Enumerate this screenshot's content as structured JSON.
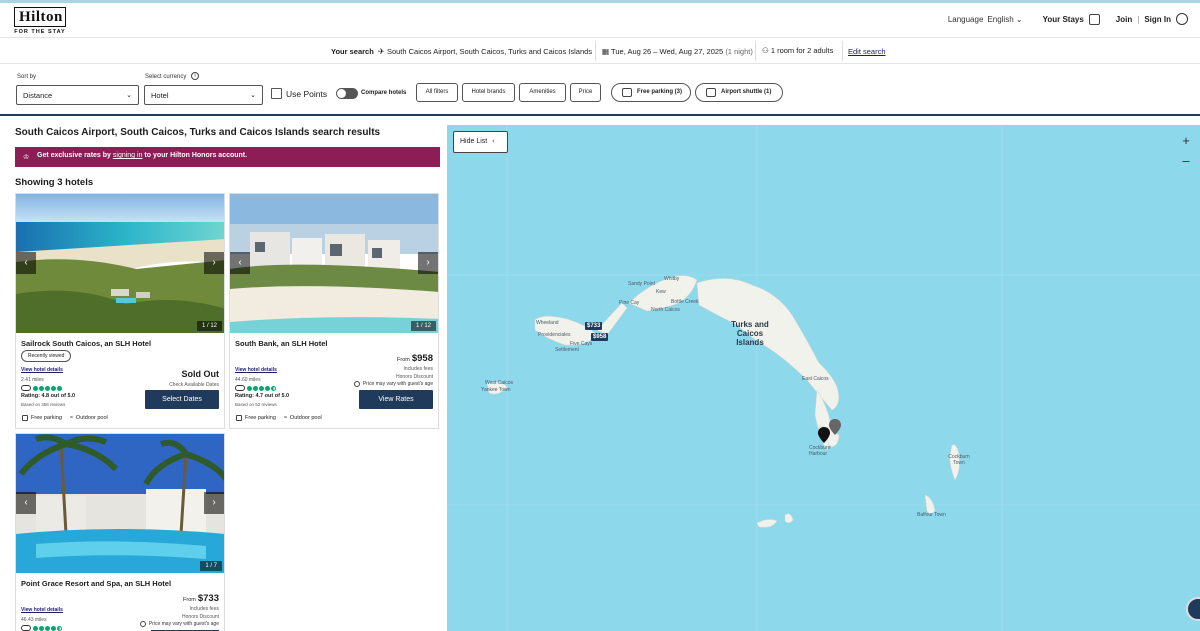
{
  "header": {
    "logo_main": "Hilton",
    "logo_tag": "FOR THE STAY",
    "language_label": "Language",
    "language_value": "English",
    "your_stays": "Your Stays",
    "join": "Join",
    "divider": "|",
    "sign_in": "Sign In"
  },
  "search": {
    "label": "Your search",
    "location": "South Caicos Airport, South Caicos, Turks and Caicos Islands",
    "dates": "Tue, Aug 26 – Wed, Aug 27, 2025",
    "nights": "(1 night)",
    "rooms": "1 room for 2 adults",
    "edit": "Edit search"
  },
  "filters": {
    "sort_label": "Sort by",
    "sort_value": "Distance",
    "currency_label": "Select currency",
    "currency_value": "Hotel",
    "use_points": "Use Points",
    "compare": "Compare hotels",
    "all_filters": "All filters",
    "hotel_brands": "Hotel brands",
    "amenities": "Amenities",
    "price": "Price",
    "free_parking": "Free parking (3)",
    "airport_shuttle": "Airport shuttle (1)"
  },
  "results": {
    "title": "South Caicos Airport, South Caicos, Turks and Caicos Islands search results",
    "banner_pre": "Get exclusive rates by ",
    "banner_link": "signing in",
    "banner_post": " to your Hilton Honors account.",
    "showing": "Showing 3 hotels"
  },
  "hotels": [
    {
      "name": "Sailrock South Caicos, an SLH Hotel",
      "badge": "Recently viewed",
      "details": "View hotel details",
      "miles": "2.41 miles",
      "rating": "Rating: 4.8 out of 5.0",
      "reviews": "Based on 358 reviews",
      "amenity1": "Free parking",
      "amenity2": "Outdoor pool",
      "photo_count": "1 / 12",
      "status": "Sold Out",
      "status_sub": "Check Available Dates",
      "button": "Select Dates"
    },
    {
      "name": "South Bank, an SLH Hotel",
      "details": "View hotel details",
      "miles": "44.60 miles",
      "rating": "Rating: 4.7 out of 5.0",
      "reviews": "Based on 52 reviews",
      "amenity1": "Free parking",
      "amenity2": "Outdoor pool",
      "photo_count": "1 / 12",
      "from": "From",
      "price": "$958",
      "fees": "Includes fees",
      "discount": "Honors Discount",
      "vary": "Price may vary with guest's age",
      "button": "View Rates"
    },
    {
      "name": "Point Grace Resort and Spa, an SLH Hotel",
      "details": "View hotel details",
      "miles": "46.43 miles",
      "photo_count": "1 / 7",
      "from": "From",
      "price": "$733",
      "fees": "Includes fees",
      "discount": "Honors Discount",
      "vary": "Price may vary with guest's age"
    }
  ],
  "map": {
    "hide_list": "Hide List",
    "zoom_in": "+",
    "zoom_out": "–",
    "labels": {
      "whitby": "Whitby",
      "sandy_point": "Sandy Point",
      "kew": "Kew",
      "bottle_creek": "Bottle Creek",
      "pine_cay": "Pine Cay",
      "north_caicos": "North Caicos",
      "wheeland": "Wheeland",
      "providenciales": "Providenciales",
      "five_cays": "Five Cays",
      "settlement": "Settlement",
      "tci": "Turks and Caicos Islands",
      "east_caicos": "East Caicos",
      "west_caicos": "West Caicos",
      "yankee_town": "Yankee Town",
      "cockburn_harbour": "Cockburn Harbour",
      "cockburn_town": "Cockburn Town",
      "balfour_town": "Balfour Town"
    },
    "pin1": "$733",
    "pin2": "$958"
  },
  "colors": {
    "brand_navy": "#1f3a5a",
    "banner": "#8c1d55",
    "water": "#8ed8ec",
    "land": "#f2f2ec"
  }
}
